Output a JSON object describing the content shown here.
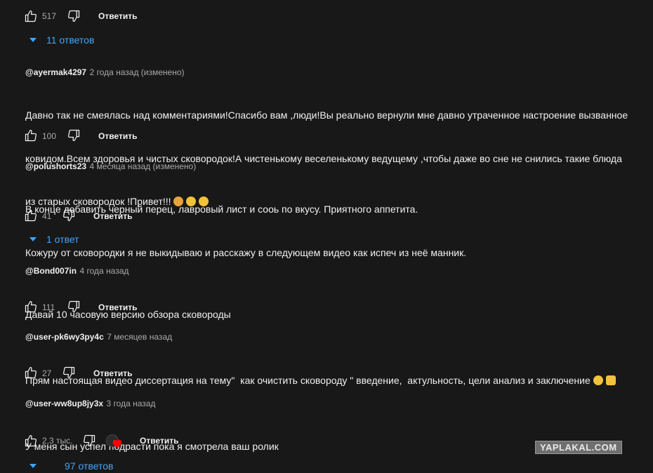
{
  "comments": [
    {
      "likes": "517",
      "reply_label": "Ответить",
      "replies": "11 ответов"
    },
    {
      "author": "@ayermak4297",
      "meta": "2 года назад (изменено)",
      "text_lines": [
        "Давно так не смеялась над комментариями!Спасибо вам ,люди!Вы реально вернули мне давно утраченное настроение вызванное",
        "ковидом.Всем здоровья и чистых сковородок!А чистенькому веселенькому ведущему ,чтобы даже во сне не снились такие блюда",
        "из старых сковородок !Привет!!!"
      ],
      "likes": "100",
      "reply_label": "Ответить"
    },
    {
      "author": "@polushorts23",
      "meta": "4 месяца назад (изменено)",
      "text_lines": [
        "В конце добавить черный перец, лавровый лист и сооь по вкусу. Приятного аппетита.",
        "Кожуру от сковородки я не выкидываю и расскажу в следующем видео как испеч из неё манник."
      ],
      "likes": "41",
      "reply_label": "Ответить",
      "replies": "1 ответ"
    },
    {
      "author": "@Bond007in",
      "meta": "4 года назад",
      "text_lines": [
        "Давай 10 часовую версию обзора сковороды"
      ],
      "likes": "111",
      "reply_label": "Ответить"
    },
    {
      "author": "@user-pk6wy3py4c",
      "meta": "7 месяцев назад",
      "text_lines": [
        "Прям настоящая видео диссертация на тему\"  как очистить сковороду \" введение,  актульность, цели анализ и заключение"
      ],
      "likes": "27",
      "reply_label": "Ответить"
    },
    {
      "author": "@user-ww8up8jy3x",
      "meta": "3 года назад",
      "text_lines": [
        "У меня сын успел подрасти пока я смотрела ваш ролик"
      ],
      "likes": "2,3 тыс.",
      "reply_label": "Ответить",
      "replies": "97 ответов"
    }
  ],
  "icons": {
    "like": "thumbs-up-icon",
    "dislike": "thumbs-down-icon",
    "expand": "caret-down-icon",
    "hearted": "creator-heart-icon"
  },
  "watermark": "YAPLAKAL.COM",
  "colors": {
    "background": "#181818",
    "link": "#3ea6ff",
    "secondary": "#aaaaaa",
    "heart": "#ff0000"
  }
}
